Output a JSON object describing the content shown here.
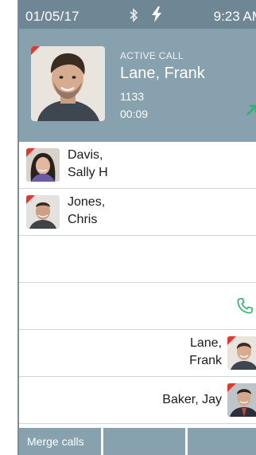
{
  "status": {
    "date": "01/05/17",
    "time": "9:23 AM",
    "bluetooth_icon": "bluetooth-icon",
    "charging_icon": "lightning-icon"
  },
  "active_call": {
    "label": "ACTIVE CALL",
    "name": "Lane, Frank",
    "extension": "1133",
    "duration": "00:09",
    "direction_icon": "outgoing-arrow-icon"
  },
  "contacts": [
    {
      "line1": "Davis,",
      "line2": "Sally H",
      "align": "left"
    },
    {
      "line1": "Jones,",
      "line2": "Chris",
      "align": "left"
    },
    {
      "line1": "Lane,",
      "line2": "Frank",
      "align": "right"
    },
    {
      "line1": "Baker, Jay",
      "align": "right"
    }
  ],
  "bottom_tabs": [
    {
      "label": "Merge calls"
    },
    {
      "label": ""
    },
    {
      "label": ""
    }
  ],
  "colors": {
    "status_bar": "#6f8795",
    "panel": "#88a1ae",
    "accent_green": "#2bb56a",
    "marker_red": "#e5372b"
  }
}
